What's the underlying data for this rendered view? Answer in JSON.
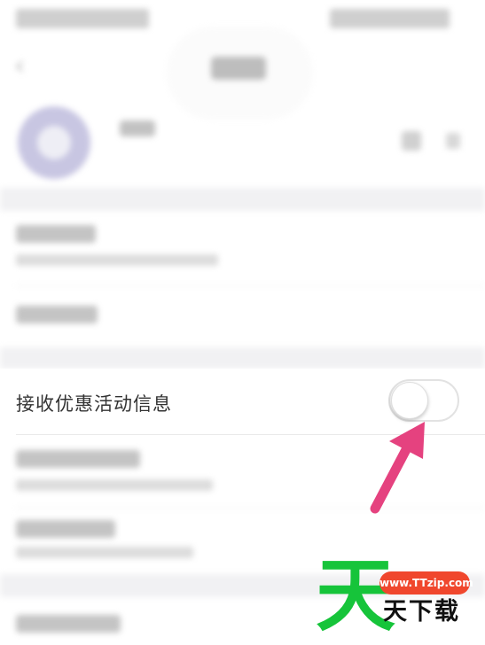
{
  "notification_row": {
    "label": "接收优惠活动信息",
    "toggle_on": false
  },
  "watermark": {
    "big_char": "天",
    "site": "www.TTzip.com",
    "brand": "天下载"
  },
  "colors": {
    "arrow": "#e5427f",
    "watermark_green": "#16c43a",
    "watermark_pill": "#f0472d",
    "avatar": "#c8c6e2"
  }
}
